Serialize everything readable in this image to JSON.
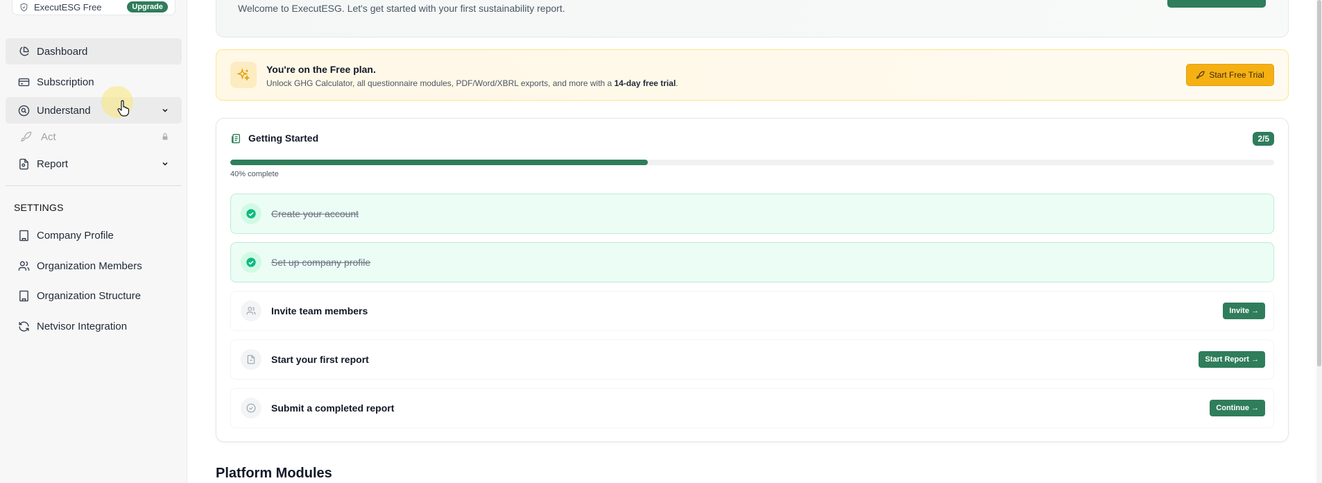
{
  "sidebar": {
    "plan": {
      "name": "ExecutESG Free",
      "upgrade_label": "Upgrade"
    },
    "nav": [
      {
        "label": "Dashboard",
        "icon": "pie-chart-icon"
      },
      {
        "label": "Subscription",
        "icon": "credit-card-icon"
      },
      {
        "label": "Understand",
        "icon": "search-circle-icon"
      },
      {
        "label": "Act",
        "icon": "rocket-icon"
      },
      {
        "label": "Report",
        "icon": "document-icon"
      }
    ],
    "settings_heading": "SETTINGS",
    "settings": [
      {
        "label": "Company Profile",
        "icon": "building-icon"
      },
      {
        "label": "Organization Members",
        "icon": "users-icon"
      },
      {
        "label": "Organization Structure",
        "icon": "building-icon"
      },
      {
        "label": "Netvisor Integration",
        "icon": "refresh-icon"
      }
    ]
  },
  "welcome": {
    "text": "Welcome to ExecutESG. Let's get started with your first sustainability report."
  },
  "free_plan": {
    "title": "You're on the Free plan.",
    "desc_prefix": "Unlock GHG Calculator, all questionnaire modules, PDF/Word/XBRL exports, and more with a ",
    "desc_bold": "14-day free trial",
    "desc_suffix": ".",
    "button_label": "Start Free Trial"
  },
  "getting_started": {
    "title": "Getting Started",
    "count": "2/5",
    "progress_fraction": 0.4,
    "progress_text": "40% complete",
    "steps": [
      {
        "label": "Create your account",
        "done": true
      },
      {
        "label": "Set up company profile",
        "done": true
      },
      {
        "label": "Invite team members",
        "done": false,
        "button": "Invite →",
        "icon": "users-icon"
      },
      {
        "label": "Start your first report",
        "done": false,
        "button": "Start Report →",
        "icon": "document-icon"
      },
      {
        "label": "Submit a completed report",
        "done": false,
        "button": "Continue →",
        "icon": "check-circle-icon"
      }
    ]
  },
  "modules_title": "Platform Modules",
  "colors": {
    "brand": "#2f7d5b",
    "trial": "#f5b014"
  }
}
